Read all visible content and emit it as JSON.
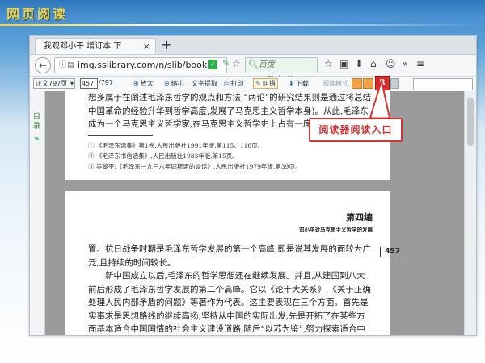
{
  "slide": {
    "title": "网页阅读"
  },
  "browser": {
    "tab_title": "我观邓小平 增订本 下",
    "tab_close": "×",
    "new_tab": "+",
    "url": "img.sslibrary.com/n/slib/book",
    "search_placeholder": "百度 <Ctrl+K>"
  },
  "toolbar": {
    "page_select": "正文797页",
    "page_input": "457",
    "page_total": "/797",
    "zoom_in": "放大",
    "zoom_out": "缩小",
    "text_extract": "文字提取",
    "print": "打印",
    "error_report": "纠错",
    "download": "下载",
    "read_mode": "阅读模式"
  },
  "left_panel": {
    "catalog": "目录",
    "expand": "»"
  },
  "page1": {
    "paragraph": "想多属于在阐述毛泽东哲学的观点和方法,“两论”的研究结果则是通过将总结中国革命的经验升华到哲学高度,发展了马克思主义哲学本身)。从此,毛泽东成为一个马克思主义哲学家,在马克思主义哲学史上占有一席",
    "footnotes": [
      "①  《毛泽东选集》第1卷,人民出版社1991年版,第115、116页。",
      "②  《毛泽东书信选集》,人民出版社1983年版,第15页。",
      "③  吴黎平:《毛泽东一九三六年同斯诺的谈话》,人民出版社1979年版,第39页。"
    ]
  },
  "page2": {
    "part_title": "第四编",
    "part_subtitle": "邓小平对马克思主义哲学的发展",
    "page_number": "457",
    "paragraph1": "置。抗日战争时期是毛泽东哲学发展的第一个高峰,即是说其发展的面较为广泛,且持续的时间较长。",
    "paragraph2": "新中国成立以后,毛泽东的哲学思想还在继续发展。并且,从建国到八大前后形成了毛泽东哲学发展的第二个高峰。它以《论十大关系》,《关于正确处理人民内部矛盾的问题》等著作为代表。这主要表现在三个方面。首先是实事求是思想路线的继续高扬,坚持从中国的实际出发,先是开拓了在某些方面基本适合中国国情的社会主义建设道路,随后“以苏为鉴”,努力探索适合中国国情的社会主"
  },
  "callout": {
    "text": "阅读器阅读入口"
  },
  "colors": {
    "callout_red": "#d93232",
    "slide_title_yellow": "#f4d23a",
    "header_blue": "#2f77bd"
  }
}
